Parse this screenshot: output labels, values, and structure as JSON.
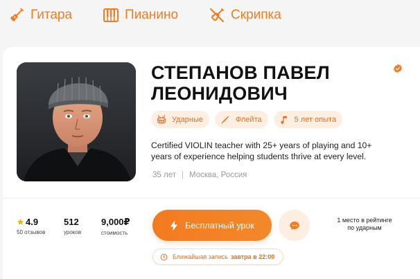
{
  "tabs": [
    {
      "label": "Гитара",
      "icon": "guitar-icon"
    },
    {
      "label": "Пианино",
      "icon": "piano-icon"
    },
    {
      "label": "Скрипка",
      "icon": "violin-icon"
    }
  ],
  "accent_color": "#f47b20",
  "teacher": {
    "name_line1": "СТЕПАНОВ ПАВЕЛ",
    "name_line2": "ЛЕОНИДОВИЧ",
    "verified_icon": "verified-badge-icon",
    "tags": [
      {
        "label": "Ударные",
        "icon": "drums-icon"
      },
      {
        "label": "Флейта",
        "icon": "flute-icon"
      },
      {
        "label": "5 лет опыта",
        "icon": "music-note-icon"
      }
    ],
    "description": "Certified VIOLIN teacher with 25+ years of playing and 10+ years of experience helping students thrive at every level.",
    "age": "35 лет",
    "meta_separator": "|",
    "location": "Москва, Россия"
  },
  "stats": {
    "rating": {
      "value": "4.9",
      "label": "50 отзывов"
    },
    "lessons": {
      "value": "512",
      "label": "уроков"
    },
    "price": {
      "value": "9,000₽",
      "label": "стоимость"
    }
  },
  "actions": {
    "free_lesson_label": "Бесплатный урок",
    "chat_icon": "chat-bubble-icon"
  },
  "ranking": {
    "line1": "1 место в рейтинге",
    "line2": "по ударным"
  },
  "nearest_booking": {
    "prefix": "Ближайшая запись",
    "time": "завтра в 22:00"
  }
}
